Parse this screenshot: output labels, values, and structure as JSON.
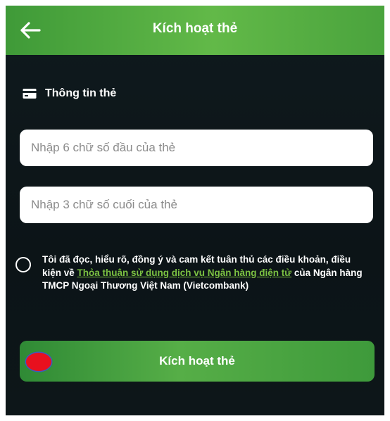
{
  "header": {
    "title": "Kích hoạt thẻ",
    "back_icon": "arrow-left-icon"
  },
  "card_section": {
    "icon": "credit-card-icon",
    "title": "Thông tin thẻ"
  },
  "form": {
    "first_digits": {
      "placeholder": "Nhập 6 chữ số đầu của thẻ",
      "value": ""
    },
    "last_digits": {
      "placeholder": "Nhập 3 chữ số cuối của thẻ",
      "value": ""
    }
  },
  "terms": {
    "checked": false,
    "text_before": "Tôi đã đọc, hiểu rõ, đồng ý và cam kết tuân thủ các điều khoản, điều kiện về ",
    "link_text": "Thỏa thuận sử dụng dịch vụ Ngân hàng điện tử",
    "text_after": " của Ngân hàng TMCP Ngoại Thương Việt Nam (Vietcombank)"
  },
  "actions": {
    "activate_label": "Kích hoạt thẻ"
  },
  "colors": {
    "brand_green": "#62b948",
    "link_green": "#7bc142",
    "background": "#0f1a1e",
    "marker_red": "#e8101e"
  }
}
